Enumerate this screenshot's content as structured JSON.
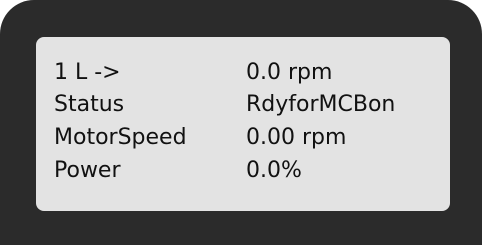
{
  "display": {
    "rows": [
      {
        "label": "1 L ->",
        "value": "0.0 rpm"
      },
      {
        "label": "Status",
        "value": "RdyforMCBon"
      },
      {
        "label": "MotorSpeed",
        "value": "0.00 rpm"
      },
      {
        "label": "Power",
        "value": "0.0%"
      }
    ]
  }
}
